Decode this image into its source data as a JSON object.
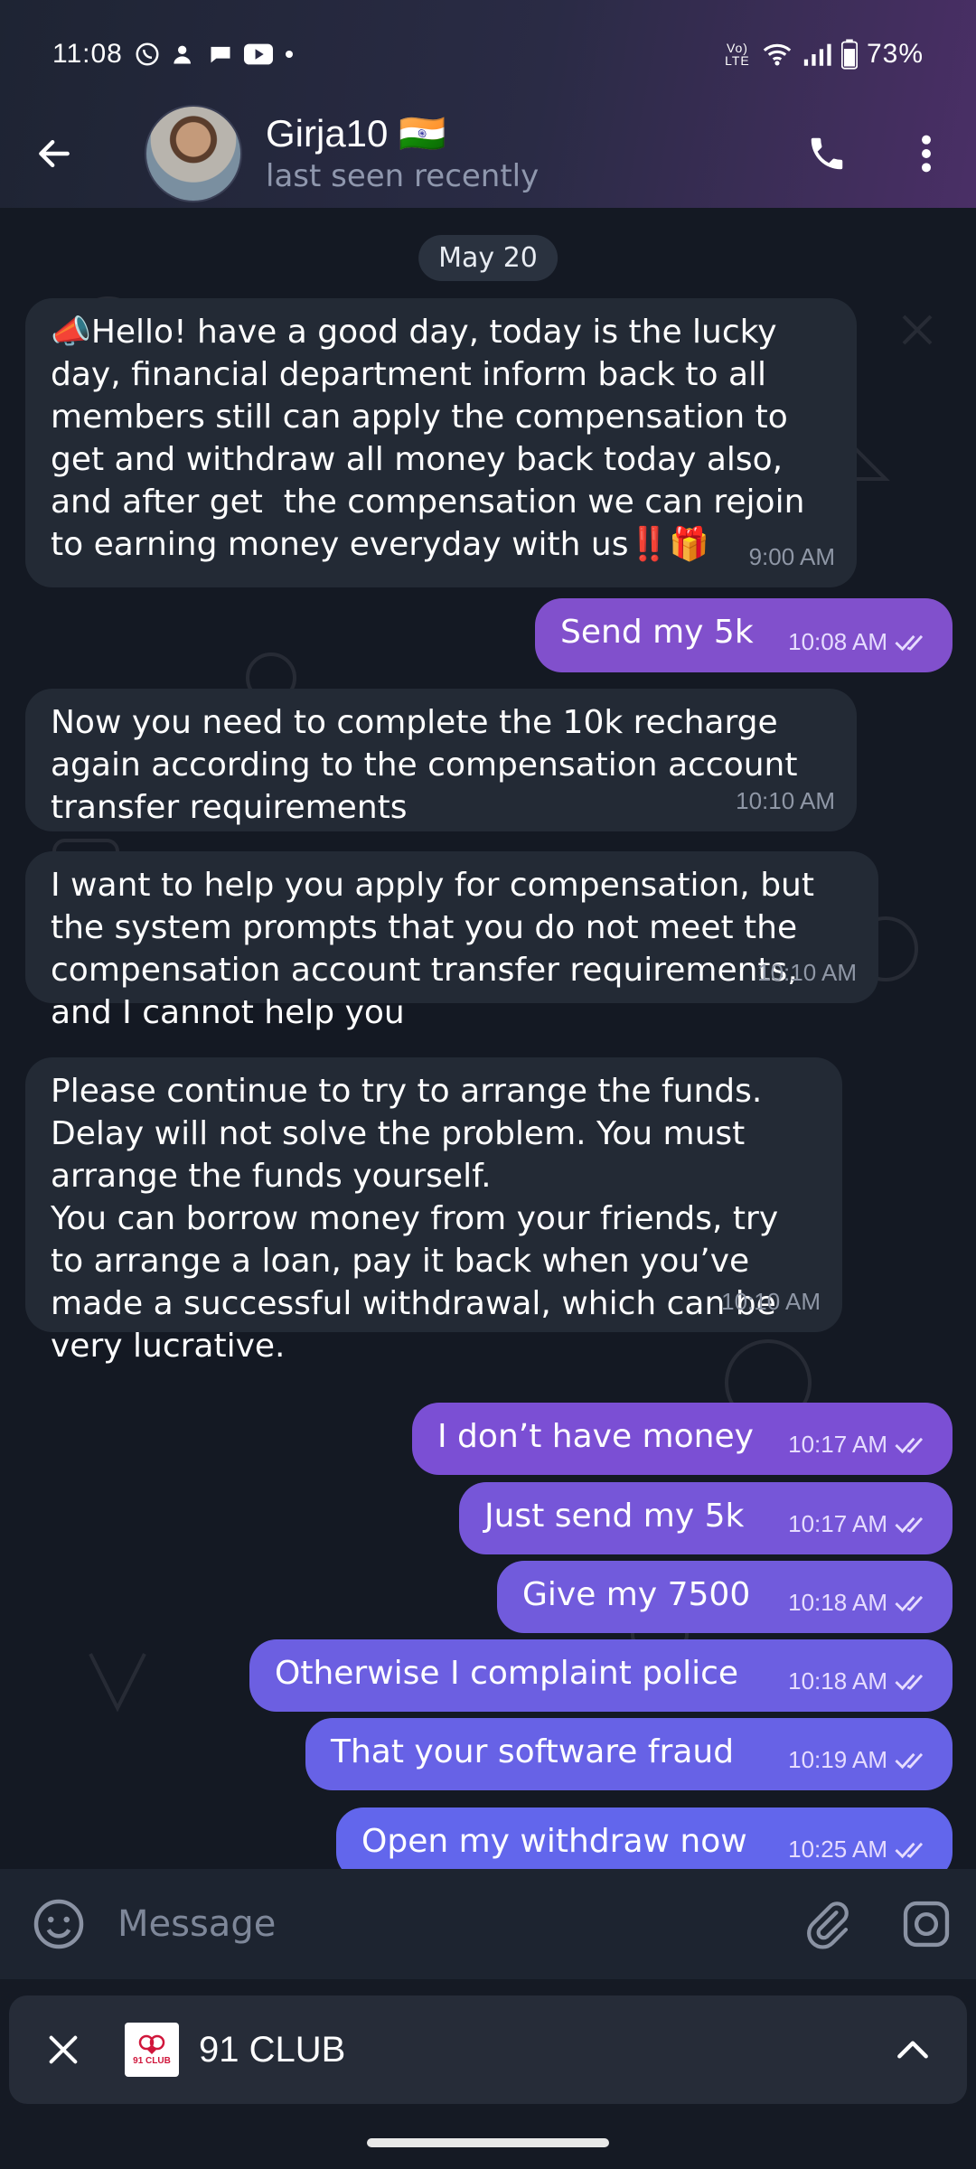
{
  "status_bar": {
    "time": "11:08",
    "battery": "73%",
    "network_label": "Vo) LTE"
  },
  "header": {
    "name": "Girja10",
    "flag": "🇮🇳",
    "status": "last seen recently"
  },
  "chat": {
    "date_label": "May 20",
    "messages": [
      {
        "dir": "in",
        "text": "📣Hello! have a good day, today is the lucky day, financial department inform back to all members still can apply the compensation to get and withdraw all money back today also, and after get  the compensation we can rejoin to earning money everyday with us‼️🎁",
        "time": "9:00 AM"
      },
      {
        "dir": "out",
        "text": "Send my 5k",
        "time": "10:08 AM"
      },
      {
        "dir": "in",
        "text": "Now you need to complete the 10k recharge again according to the compensation account transfer requirements",
        "time": "10:10 AM"
      },
      {
        "dir": "in",
        "text": "I want to help you apply for compensation, but the system prompts that you do not meet the compensation account transfer requirements, and I cannot help you",
        "time": "10:10 AM"
      },
      {
        "dir": "in",
        "text": "Please continue to try to arrange the funds. Delay will not solve the problem. You must arrange the funds yourself.\nYou can borrow money from your friends, try to arrange a loan, pay it back when you’ve made a successful withdrawal, which can be very lucrative.",
        "time": "10:10 AM"
      },
      {
        "dir": "out",
        "text": "I don’t have money",
        "time": "10:17 AM"
      },
      {
        "dir": "out",
        "text": "Just send my 5k",
        "time": "10:17 AM"
      },
      {
        "dir": "out",
        "text": "Give my 7500",
        "time": "10:18 AM"
      },
      {
        "dir": "out",
        "text": "Otherwise I complaint police",
        "time": "10:18 AM"
      },
      {
        "dir": "out",
        "text": "That your software fraud",
        "time": "10:19 AM"
      },
      {
        "dir": "out",
        "text": "Open my withdraw now",
        "time": "10:25 AM"
      }
    ]
  },
  "composer": {
    "placeholder": "Message"
  },
  "pinned_notice": {
    "title": "91 CLUB",
    "logo_text": "91 CLUB"
  },
  "icons": {
    "back": "arrow-left-icon",
    "call": "phone-icon",
    "menu": "more-vertical-icon",
    "emoji": "smiley-icon",
    "attach": "paperclip-icon",
    "camera": "camera-icon",
    "close": "close-icon",
    "expand": "chevron-up-icon",
    "read": "double-check-icon"
  },
  "colors": {
    "incoming_bubble": "#232a35",
    "outgoing_bubble_top": "#7a4fd0",
    "outgoing_bubble_bottom": "#6a62ec",
    "accent": "#8a5ad8"
  }
}
